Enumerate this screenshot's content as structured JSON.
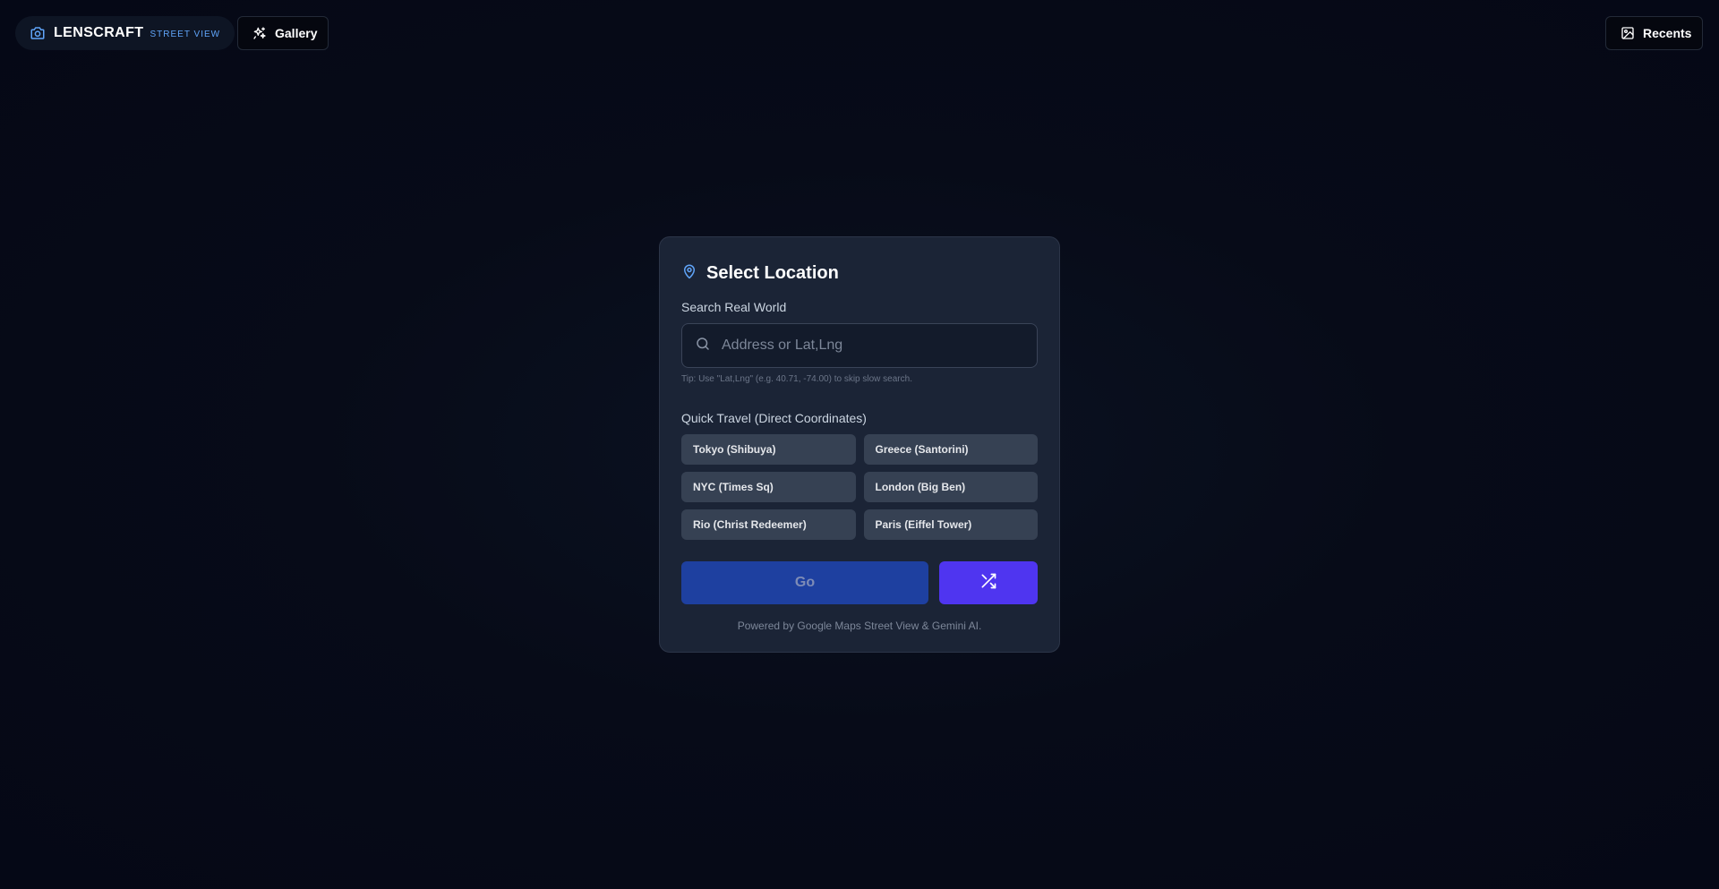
{
  "header": {
    "brand_name": "LENSCRAFT",
    "brand_sub": "STREET VIEW",
    "brand_icon": "camera-icon",
    "gallery_label": "Gallery",
    "gallery_icon": "sparkles-icon",
    "recents_label": "Recents",
    "recents_icon": "image-icon"
  },
  "card": {
    "title": "Select Location",
    "title_icon": "map-pin-icon",
    "search_label": "Search Real World",
    "search_placeholder": "Address or Lat,Lng",
    "search_value": "",
    "tip": "Tip: Use \"Lat,Lng\" (e.g. 40.71, -74.00) to skip slow search.",
    "quick_label": "Quick Travel (Direct Coordinates)",
    "quick_items": [
      "Tokyo (Shibuya)",
      "Greece (Santorini)",
      "NYC (Times Sq)",
      "London (Big Ben)",
      "Rio (Christ Redeemer)",
      "Paris (Eiffel Tower)"
    ],
    "go_label": "Go",
    "shuffle_icon": "shuffle-icon",
    "footer": "Powered by Google Maps Street View & Gemini AI."
  },
  "colors": {
    "background": "#050816",
    "card": "#1b2436",
    "accent_blue": "#60a5fa",
    "go_button": "#1e40a0",
    "shuffle_button": "#4f35f0",
    "quick_button": "#364153"
  }
}
